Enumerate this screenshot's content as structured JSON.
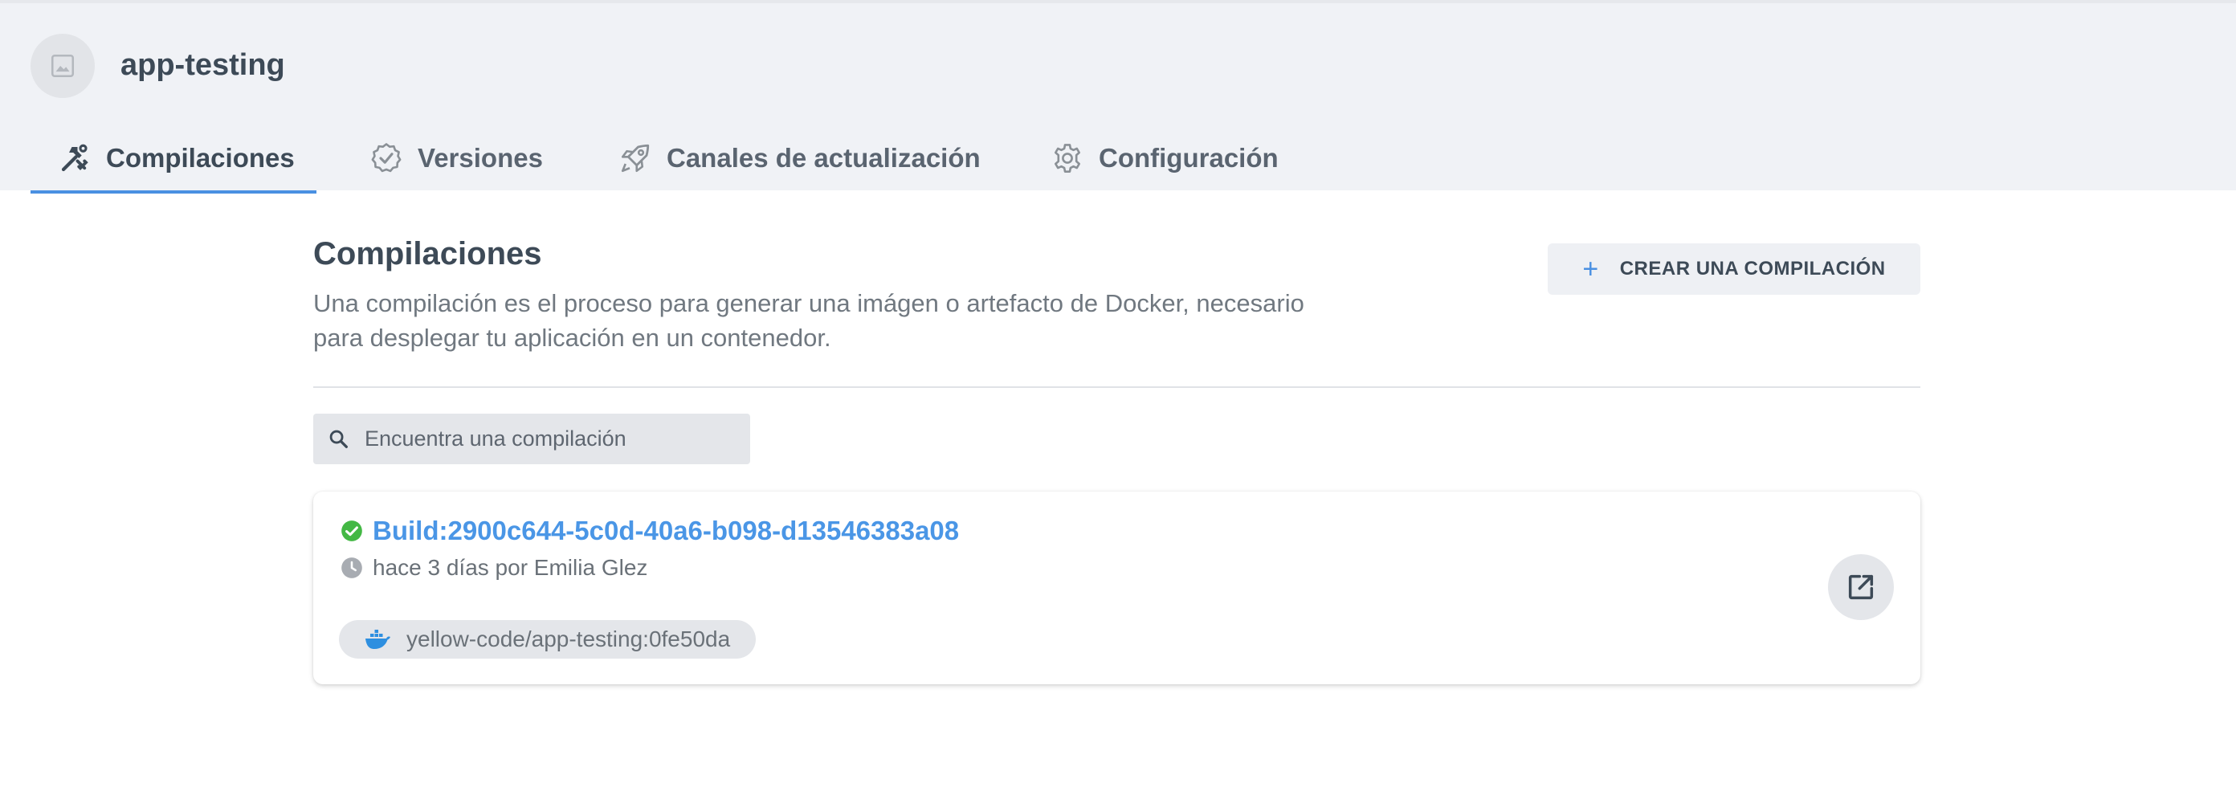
{
  "app": {
    "name": "app-testing"
  },
  "tabs": [
    {
      "label": "Compilaciones",
      "icon": "tools-icon",
      "active": true
    },
    {
      "label": "Versiones",
      "icon": "badge-check-icon",
      "active": false
    },
    {
      "label": "Canales de actualización",
      "icon": "rocket-icon",
      "active": false
    },
    {
      "label": "Configuración",
      "icon": "gear-icon",
      "active": false
    }
  ],
  "section": {
    "title": "Compilaciones",
    "description": "Una compilación es el proceso para generar una imágen o artefacto de Docker, necesario para desplegar tu aplicación en un contenedor.",
    "create_button": "CREAR UNA COMPILACIÓN",
    "create_icon": "+"
  },
  "search": {
    "placeholder": "Encuentra una compilación",
    "value": ""
  },
  "builds": [
    {
      "title": "Build:2900c644-5c0d-40a6-b098-d13546383a08",
      "status": "success",
      "meta": "hace 3 días por Emilia Glez",
      "image": "yellow-code/app-testing:0fe50da"
    }
  ],
  "colors": {
    "accent": "#4a90e2",
    "link": "#4a96e6",
    "success": "#43b844",
    "header_bg": "#f0f2f6"
  }
}
